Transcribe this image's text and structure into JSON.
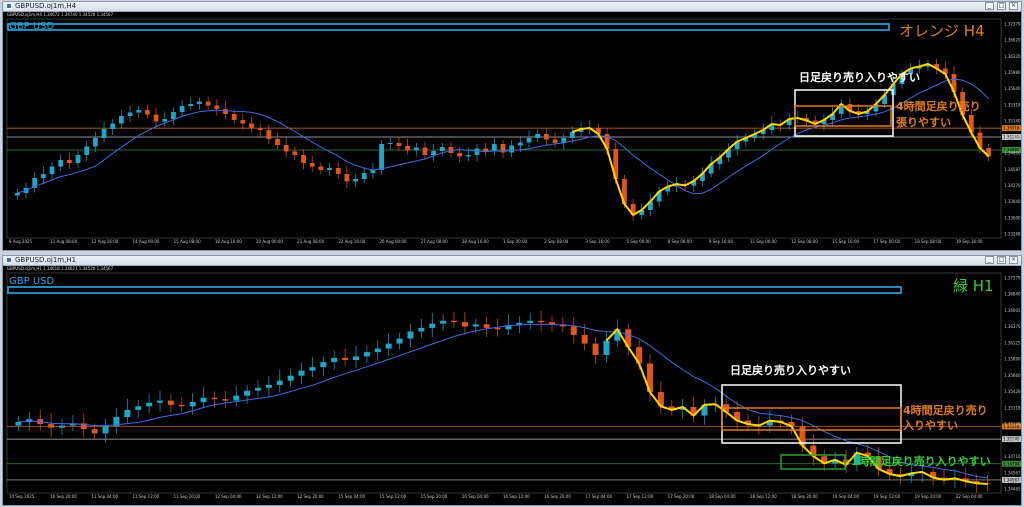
{
  "top": {
    "window_title": "GBPUSD.oj1m,H4",
    "info": "GBPUSD.oj1m,H4  1.34672 1.34740 1.34526 1.34567",
    "symbol_label": "GBP USD",
    "timeframe_label": "オレンジ H4",
    "notes": [
      "日足戻り売り入りやすい",
      "4時間足戻り売り",
      "張りやすい"
    ],
    "y_ticks": [
      "1.37379",
      "1.36620",
      "1.36320",
      "1.35980",
      "1.35640",
      "1.35318",
      "1.35140",
      "1.34965",
      "1.34800",
      "1.34587",
      "1.34270",
      "1.33940",
      "1.33600",
      "1.33268"
    ],
    "x_ticks": [
      "8 Aug 2025",
      "11 Aug 08:00",
      "12 Aug 16:00",
      "14 Aug 00:00",
      "15 Aug 08:00",
      "18 Aug 16:00",
      "20 Aug 00:00",
      "21 Aug 08:00",
      "22 Aug 16:00",
      "26 Aug 00:00",
      "27 Aug 08:00",
      "28 Aug 16:00",
      "1 Sep 00:00",
      "2 Sep 08:00",
      "3 Sep 16:00",
      "5 Sep 00:00",
      "8 Sep 08:00",
      "9 Sep 16:00",
      "11 Sep 00:00",
      "12 Sep 08:00",
      "15 Sep 16:00",
      "17 Sep 00:00",
      "18 Sep 08:00",
      "19 Sep 16:00"
    ],
    "close": [
      1.3402,
      1.3412,
      1.3432,
      1.344,
      1.3455,
      1.3468,
      1.3462,
      1.3478,
      1.3495,
      1.3512,
      1.353,
      1.3541,
      1.3556,
      1.3563,
      1.3568,
      1.3559,
      1.3545,
      1.355,
      1.3564,
      1.3576,
      1.358,
      1.3585,
      1.3577,
      1.357,
      1.356,
      1.3548,
      1.3541,
      1.3532,
      1.3528,
      1.351,
      1.3498,
      1.3485,
      1.3478,
      1.3462,
      1.3455,
      1.3448,
      1.3452,
      1.344,
      1.3425,
      1.343,
      1.3442,
      1.3448,
      1.35,
      1.3502,
      1.3496,
      1.3487,
      1.3493,
      1.3478,
      1.3486,
      1.3494,
      1.3482,
      1.3475,
      1.3478,
      1.3491,
      1.3485,
      1.35,
      1.3483,
      1.3497,
      1.3503,
      1.3512,
      1.352,
      1.3509,
      1.3502,
      1.3512,
      1.3524,
      1.353,
      1.3532,
      1.352,
      1.349,
      1.343,
      1.338,
      1.3358,
      1.3368,
      1.3385,
      1.3405,
      1.3415,
      1.342,
      1.3417,
      1.3426,
      1.3441,
      1.346,
      1.3473,
      1.349,
      1.3505,
      1.3512,
      1.352,
      1.3528,
      1.354,
      1.3538,
      1.355,
      1.3552,
      1.3547,
      1.354,
      1.3548,
      1.356,
      1.358,
      1.3566,
      1.356,
      1.3565,
      1.358,
      1.3598,
      1.362,
      1.364,
      1.3651,
      1.3655,
      1.366,
      1.3651,
      1.364,
      1.3604,
      1.3558,
      1.3523,
      1.3492,
      1.3475
    ],
    "levels": [
      {
        "price": 1.35318,
        "color": "#d9791a",
        "label": "1.35318"
      },
      {
        "price": 1.3514,
        "color": "#bfbfbf",
        "label": "1.35140"
      },
      {
        "price": 1.3488,
        "color": "#3a8c3a",
        "label": "1.34880"
      }
    ],
    "colors": {
      "bull": "#1fa6c9",
      "bear": "#e0561b",
      "ma": "#4169e1",
      "trend": "#ffd700",
      "box_white": "#ffffff",
      "box_orange": "#e07b1b",
      "symbol": "#2aa9e6",
      "label": "#e07b1b"
    }
  },
  "bottom": {
    "window_title": "GBPUSD.oj1m,H1",
    "info": "GBPUSD.oj1m,H1  1.34618 1.34621 1.34526 1.34567",
    "symbol_label": "GBP USD",
    "timeframe_label": "緑 H1",
    "notes": [
      "日足戻り売り入りやすい",
      "4時間足戻り売り",
      "入りやすい",
      "1時間足戻り売り入りやすい"
    ],
    "y_ticks": [
      "1.37379",
      "1.36840",
      "1.36605",
      "1.36370",
      "1.36125",
      "1.35890",
      "1.35660",
      "1.35428",
      "1.35318",
      "1.35140",
      "1.34944",
      "1.34716",
      "1.34567",
      "1.34465"
    ],
    "x_ticks": [
      "10 Sep 2025",
      "10 Sep 20:00",
      "11 Sep 04:00",
      "11 Sep 12:00",
      "11 Sep 20:00",
      "12 Sep 04:00",
      "12 Sep 12:00",
      "12 Sep 20:00",
      "15 Sep 04:00",
      "15 Sep 12:00",
      "15 Sep 20:00",
      "16 Sep 04:00",
      "16 Sep 12:00",
      "16 Sep 20:00",
      "17 Sep 04:00",
      "17 Sep 12:00",
      "17 Sep 20:00",
      "18 Sep 04:00",
      "18 Sep 12:00",
      "18 Sep 20:00",
      "19 Sep 04:00",
      "19 Sep 12:00",
      "19 Sep 20:00",
      "22 Sep 04:00"
    ],
    "close": [
      1.3538,
      1.3542,
      1.3535,
      1.353,
      1.3533,
      1.3536,
      1.3528,
      1.3522,
      1.3532,
      1.3545,
      1.3555,
      1.356,
      1.3565,
      1.3568,
      1.3562,
      1.356,
      1.3566,
      1.3572,
      1.357,
      1.3568,
      1.3575,
      1.3582,
      1.3586,
      1.359,
      1.3596,
      1.3603,
      1.361,
      1.3615,
      1.3622,
      1.3628,
      1.3625,
      1.363,
      1.3636,
      1.3641,
      1.3648,
      1.3655,
      1.3665,
      1.367,
      1.3676,
      1.368,
      1.3678,
      1.3672,
      1.3675,
      1.367,
      1.3668,
      1.3674,
      1.3677,
      1.368,
      1.3678,
      1.3675,
      1.3672,
      1.366,
      1.3648,
      1.3632,
      1.3652,
      1.3668,
      1.3643,
      1.362,
      1.358,
      1.356,
      1.3555,
      1.3559,
      1.3547,
      1.3562,
      1.3563,
      1.3552,
      1.354,
      1.3535,
      1.3533,
      1.354,
      1.3538,
      1.3532,
      1.3505,
      1.349,
      1.348,
      1.3485,
      1.3478,
      1.3495,
      1.349,
      1.3472,
      1.3465,
      1.3462,
      1.3466,
      1.3468,
      1.346,
      1.3457,
      1.3459,
      1.3455,
      1.3452,
      1.3451
    ],
    "levels": [
      {
        "price": 1.35318,
        "color": "#d9791a",
        "label": "1.35318"
      },
      {
        "price": 1.3514,
        "color": "#bfbfbf",
        "label": "1.35140"
      },
      {
        "price": 1.34794,
        "color": "#3a8c3a",
        "label": "1.34794"
      },
      {
        "price": 1.34567,
        "color": "#bfbfbf",
        "label": "1.34567"
      }
    ],
    "colors": {
      "bull": "#1fa6c9",
      "bear": "#e0561b",
      "ma": "#4169e1",
      "trend": "#ffd700",
      "box_white": "#ffffff",
      "box_orange": "#e07b1b",
      "box_green": "#2ca02c",
      "symbol": "#2aa9e6",
      "label": "#e07b1b",
      "label_green": "#33cc33"
    }
  }
}
